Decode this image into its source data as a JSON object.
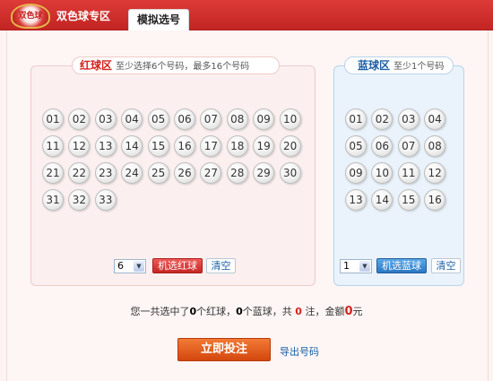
{
  "header": {
    "logo_text": "双色球",
    "tabs": [
      {
        "label": "双色球专区"
      },
      {
        "label": "模拟选号"
      }
    ]
  },
  "red_zone": {
    "title": "红球区",
    "hint": "至少选择6个号码，最多16个号码",
    "balls": [
      "01",
      "02",
      "03",
      "04",
      "05",
      "06",
      "07",
      "08",
      "09",
      "10",
      "11",
      "12",
      "13",
      "14",
      "15",
      "16",
      "17",
      "18",
      "19",
      "20",
      "21",
      "22",
      "23",
      "24",
      "25",
      "26",
      "27",
      "28",
      "29",
      "30",
      "31",
      "32",
      "33"
    ],
    "count_select": "6",
    "random_button": "机选红球",
    "clear_button": "清空"
  },
  "blue_zone": {
    "title": "蓝球区",
    "hint": "至少1个号码",
    "balls": [
      "01",
      "02",
      "03",
      "04",
      "05",
      "06",
      "07",
      "08",
      "09",
      "10",
      "11",
      "12",
      "13",
      "14",
      "15",
      "16"
    ],
    "count_select": "1",
    "random_button": "机选蓝球",
    "clear_button": "清空"
  },
  "summary": {
    "p1": "您一共选中了",
    "red_count": "0",
    "p2": "个红球，",
    "blue_count": "0",
    "p3": "个蓝球，共 ",
    "bets": "0",
    "p4": " 注，金额",
    "amount": "0",
    "p5": "元"
  },
  "actions": {
    "submit": "立即投注",
    "export": "导出号码"
  }
}
